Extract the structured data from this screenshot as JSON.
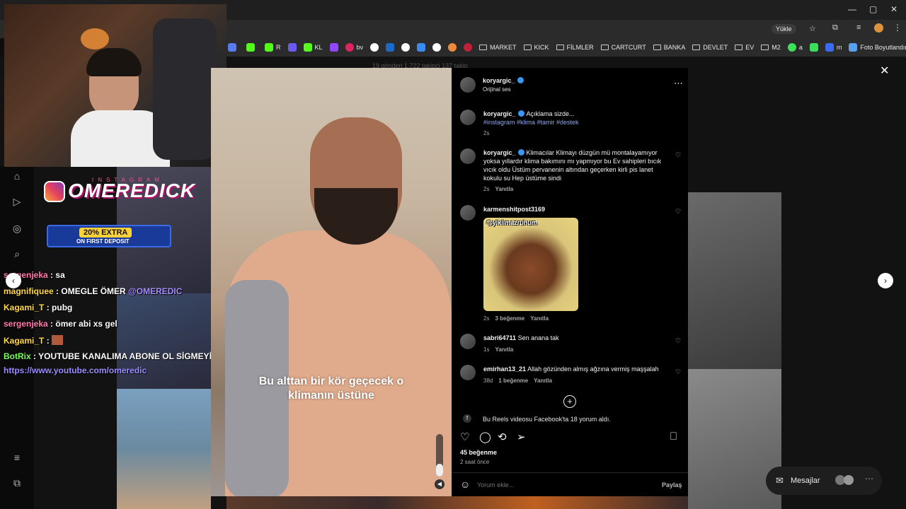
{
  "browser": {
    "upload_label": "Yükle",
    "bookmarks": [
      {
        "label": "",
        "color": "#5a7af0"
      },
      {
        "label": "",
        "color": "#53fc18"
      },
      {
        "label": "R",
        "color": "#53fc18"
      },
      {
        "label": "",
        "color": "#6a5af0"
      },
      {
        "label": "KL",
        "color": "#53fc18"
      },
      {
        "label": "",
        "color": "#9146ff"
      },
      {
        "label": "bv",
        "color": "#e0245e"
      },
      {
        "label": "",
        "color": "#ffffff"
      },
      {
        "label": "",
        "color": "#1b6ac9"
      },
      {
        "label": "",
        "color": "#ffffff"
      },
      {
        "label": "",
        "color": "#3a8af0"
      },
      {
        "label": "",
        "color": "#ffffff"
      },
      {
        "label": "",
        "color": "#f08a3a"
      },
      {
        "label": "",
        "color": "#c0203a"
      }
    ],
    "folders": [
      "MARKET",
      "KICK",
      "FİLMLER",
      "CARTCURT",
      "BANKA",
      "DEVLET",
      "EV",
      "M2"
    ],
    "extra_bookmarks": [
      "a",
      "",
      "m",
      "Foto Boyutlandırıcı"
    ]
  },
  "overlay": {
    "instagram_label": "INSTAGRAM",
    "channel_name": "OMEREDICK",
    "promo_main": "20% EXTRA",
    "promo_sub": "ON FIRST DEPOSIT"
  },
  "chat": [
    {
      "user": "sergenjeka",
      "sep": " : ",
      "text": "sa",
      "user_color": "pink"
    },
    {
      "user": "magnifiquee",
      "sep": " : ",
      "text": "OMEGLE ÖMER ",
      "mention": "@OMEREDIC",
      "user_color": "yellow"
    },
    {
      "user": "Kagami_T",
      "sep": " : ",
      "text": "pubg",
      "user_color": "yellow"
    },
    {
      "user": "sergenjeka",
      "sep": " : ",
      "text": "ömer abi xs gel",
      "user_color": "pink"
    },
    {
      "user": "Kagami_T",
      "sep": " : ",
      "text": "",
      "user_color": "yellow"
    },
    {
      "user": "BotRix",
      "sep": " : ",
      "text": "YOUTUBE KANALIMA ABONE OL SİGMEYİM:",
      "user_color": "green"
    },
    {
      "user": "",
      "sep": "",
      "text": "https://www.youtube.com/omeredic",
      "user_color": "link"
    }
  ],
  "reel": {
    "caption_line1": "Bu alttan bir kör geçecek o",
    "caption_line2": "klimanın üstüne"
  },
  "post": {
    "author": "koryargic_",
    "audio": "Orijinal ses",
    "more_icon": "more-icon",
    "caption": {
      "user": "koryargic_",
      "text": "Açıklama sizde...",
      "hashtags": "#instagram #klima #tamir #destek",
      "time": "2s"
    },
    "comments": [
      {
        "user": "koryargic_",
        "verified": true,
        "text": "Klimacılar Klimayı düzgün mü montalayamıyor yoksa yıllardır klima bakımını mı yapmıyor bu Ev sahipleri bıcık vıcık oldu Üstüm pervanenin altından geçerken kirli pis lanet kokulu su Hep üstüme sindi",
        "time": "2s",
        "likes": "",
        "reply": "Yanıtla"
      },
      {
        "user": "karmenshitpost3169",
        "verified": false,
        "text": "",
        "gif_label": "@yikilmazruhum",
        "time": "2s",
        "likes": "3 beğenme",
        "reply": "Yanıtla"
      },
      {
        "user": "sabri64711",
        "verified": false,
        "text": "Sen anana tak",
        "time": "1s",
        "likes": "",
        "reply": "Yanıtla"
      },
      {
        "user": "emirhan13_21",
        "verified": false,
        "text": "Allah gözünden almış ağzına vermiş maşşalah",
        "time": "38d",
        "likes": "1 beğenme",
        "reply": "Yanıtla"
      }
    ],
    "facebook_note": "Bu Reels videosu Facebook'ta 18 yorum aldı.",
    "likes": "45 beğenme",
    "posted": "2 saat önce",
    "comment_placeholder": "Yorum ekle...",
    "share_label": "Paylaş"
  },
  "profile_bg": {
    "stats": "19 gönderi   1.722 takipçi   137 takip"
  },
  "messages_label": "Mesajlar"
}
